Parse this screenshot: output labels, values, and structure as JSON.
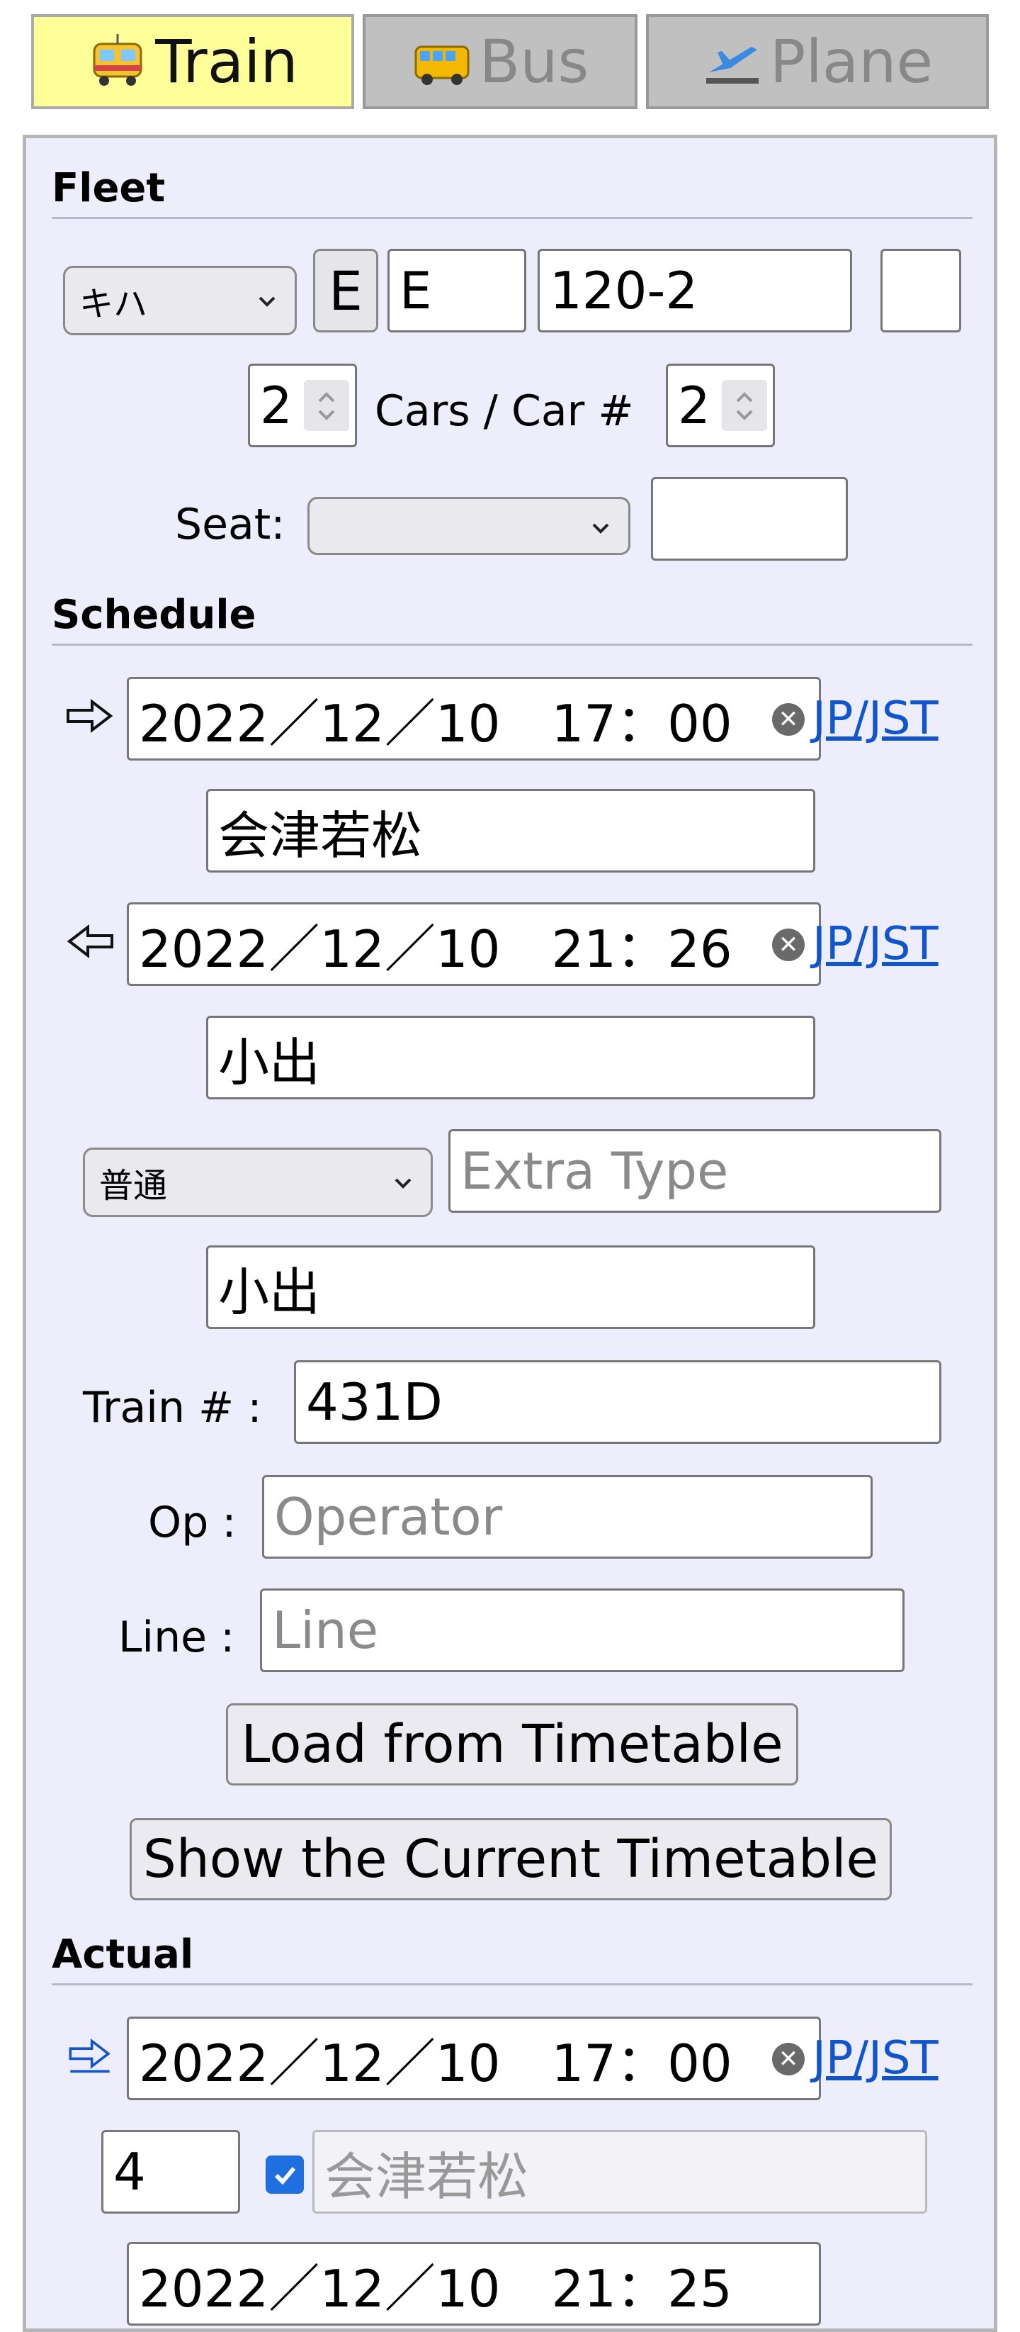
{
  "tabs": [
    {
      "label": "Train",
      "active": true,
      "icon": "train-icon"
    },
    {
      "label": "Bus",
      "active": false,
      "icon": "bus-icon"
    },
    {
      "label": "Plane",
      "active": false,
      "icon": "plane-icon"
    }
  ],
  "fleet": {
    "section_title": "Fleet",
    "type_select": "キハ",
    "prefix_button": "E",
    "prefix_value": "E",
    "number_value": "120-2",
    "suffix_value": "",
    "cars_value": "2",
    "cars_label": "Cars / Car #",
    "car_number_value": "2",
    "seat_label": "Seat:",
    "seat_select": "",
    "seat_value": ""
  },
  "schedule": {
    "section_title": "Schedule",
    "departure_datetime": "2022／12／10　17：00",
    "departure_tz": "JP/JST",
    "departure_station": "会津若松",
    "arrival_datetime": "2022／12／10　21：26",
    "arrival_tz": "JP/JST",
    "arrival_station": "小出",
    "train_type_select": "普通",
    "extra_type_placeholder": "Extra Type",
    "destination_value": "小出",
    "train_number_label": "Train # :",
    "train_number_value": "431D",
    "operator_label": "Op :",
    "operator_placeholder": "Operator",
    "line_label": "Line :",
    "line_placeholder": "Line",
    "load_button": "Load from Timetable",
    "show_button": "Show the Current Timetable"
  },
  "actual": {
    "section_title": "Actual",
    "departure_datetime": "2022／12／10　17：00",
    "departure_tz": "JP/JST",
    "platform_value": "4",
    "same_station_checked": true,
    "station_value": "会津若松",
    "arrival_datetime_partial": "2022／12／10　21：25"
  },
  "colors": {
    "active_tab": "#ffff99",
    "inactive_tab": "#c0c0c0",
    "panel_bg": "#ededfb",
    "link": "#1155cc",
    "checkbox": "#1f6fe0"
  }
}
